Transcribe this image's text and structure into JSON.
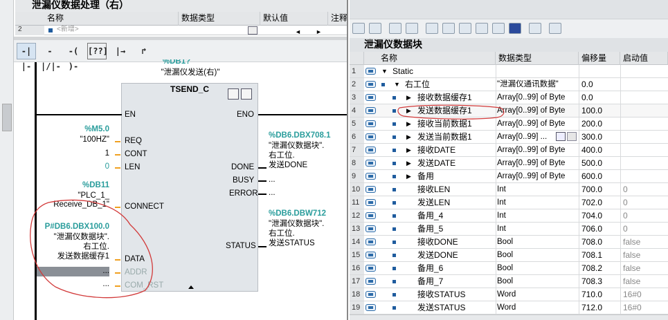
{
  "left_pane": {
    "interface": {
      "title": "泄漏仪数据处理（右）",
      "columns": [
        "名称",
        "数据类型",
        "默认值",
        "注释"
      ],
      "row_num": "2",
      "new_placeholder": "<新增>"
    },
    "toolbar": [
      "-| |-",
      "-|/|-",
      "-( )-",
      "[??]",
      "|→",
      "↱"
    ],
    "block": {
      "instance_top": "%DB1?",
      "instance_name": "\"泄漏仪发送(右)\"",
      "type": "TSEND_C",
      "inputs": [
        "EN",
        "REQ",
        "CONT",
        "LEN",
        "CONNECT",
        "DATA",
        "ADDR",
        "COM_RST"
      ],
      "outputs": [
        "ENO",
        "DONE",
        "BUSY",
        "ERROR",
        "STATUS"
      ]
    },
    "operands": {
      "req_addr": "%M5.0",
      "req_name": "\"100HZ\"",
      "cont_val": "1",
      "len_val": "0",
      "connect_addr": "%DB11",
      "connect_name_1": "\"PLC_1_",
      "connect_name_2": "Receive_DB_1\"",
      "data_addr": "P#DB6.DBX100.0",
      "data_name_1": "\"泄漏仪数据块\".",
      "data_name_2": "右工位.",
      "data_name_3": "发送数据缓存1",
      "addr_val": "...",
      "comrst_val": "...",
      "done_addr": "%DB6.DBX708.1",
      "done_name_1": "\"泄漏仪数据块\".",
      "done_name_2": "右工位.",
      "done_name_3": "发送DONE",
      "busy_val": "...",
      "error_val": "...",
      "status_addr": "%DB6.DBW712",
      "status_name_1": "\"泄漏仪数据块\".",
      "status_name_2": "右工位.",
      "status_name_3": "发送STATUS"
    }
  },
  "right_pane": {
    "title": "泄漏仪数据块",
    "columns": [
      "名称",
      "数据类型",
      "偏移量",
      "启动值"
    ],
    "rows": [
      {
        "num": "1",
        "name": "Static",
        "type": "",
        "offset": "",
        "start": ""
      },
      {
        "num": "2",
        "name": "右工位",
        "type": "\"泄漏仪通讯数据\"",
        "offset": "0.0",
        "start": ""
      },
      {
        "num": "3",
        "name": "接收数据缓存1",
        "type": "Array[0..99] of Byte",
        "offset": "0.0",
        "start": ""
      },
      {
        "num": "4",
        "name": "发送数据缓存1",
        "type": "Array[0..99] of Byte",
        "offset": "100.0",
        "start": ""
      },
      {
        "num": "5",
        "name": "接收当前数据1",
        "type": "Array[0..99] of Byte",
        "offset": "200.0",
        "start": ""
      },
      {
        "num": "6",
        "name": "发送当前数据1",
        "type": "Array[0..99] ...",
        "offset": "300.0",
        "start": ""
      },
      {
        "num": "7",
        "name": "接收DATE",
        "type": "Array[0..99] of Byte",
        "offset": "400.0",
        "start": ""
      },
      {
        "num": "8",
        "name": "发送DATE",
        "type": "Array[0..99] of Byte",
        "offset": "500.0",
        "start": ""
      },
      {
        "num": "9",
        "name": "备用",
        "type": "Array[0..99] of Byte",
        "offset": "600.0",
        "start": ""
      },
      {
        "num": "10",
        "name": "接收LEN",
        "type": "Int",
        "offset": "700.0",
        "start": "0"
      },
      {
        "num": "11",
        "name": "发送LEN",
        "type": "Int",
        "offset": "702.0",
        "start": "0"
      },
      {
        "num": "12",
        "name": "备用_4",
        "type": "Int",
        "offset": "704.0",
        "start": "0"
      },
      {
        "num": "13",
        "name": "备用_5",
        "type": "Int",
        "offset": "706.0",
        "start": "0"
      },
      {
        "num": "14",
        "name": "接收DONE",
        "type": "Bool",
        "offset": "708.0",
        "start": "false"
      },
      {
        "num": "15",
        "name": "发送DONE",
        "type": "Bool",
        "offset": "708.1",
        "start": "false"
      },
      {
        "num": "16",
        "name": "备用_6",
        "type": "Bool",
        "offset": "708.2",
        "start": "false"
      },
      {
        "num": "17",
        "name": "备用_7",
        "type": "Bool",
        "offset": "708.3",
        "start": "false"
      },
      {
        "num": "18",
        "name": "接收STATUS",
        "type": "Word",
        "offset": "710.0",
        "start": "16#0"
      },
      {
        "num": "19",
        "name": "发送STATUS",
        "type": "Word",
        "offset": "712.0",
        "start": "16#0"
      }
    ]
  },
  "colors": {
    "teal": "#2a9d9c",
    "annotation_red": "#d23a3a",
    "block_fill": "#e2e6ea"
  }
}
